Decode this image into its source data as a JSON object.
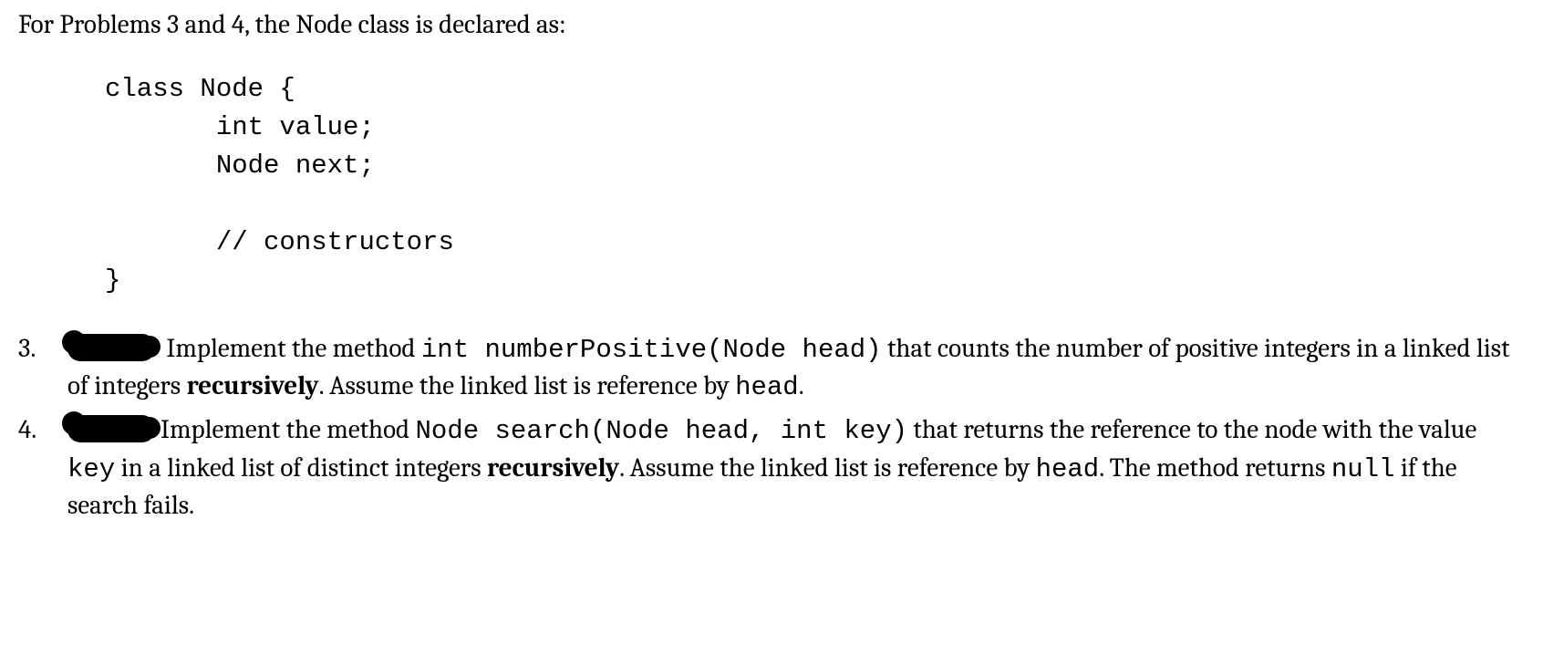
{
  "intro": "For Problems 3 and 4, the Node class is declared as:",
  "code": "class Node {\n       int value;\n       Node next;\n\n       // constructors\n}",
  "problems": {
    "p3": {
      "t1": " Implement the method ",
      "sig": "int numberPositive(Node head)",
      "t2": " that counts the number of positive integers in a linked list of integers ",
      "bold": "recursively",
      "t3": ".  Assume the linked list is reference by ",
      "headword": "head",
      "t4": "."
    },
    "p4": {
      "t1": "Implement the method ",
      "sig": "Node search(Node head, int key)",
      "t2": " that returns the reference to the node with the value ",
      "key": "key",
      "t3": " in a linked list of distinct integers ",
      "bold": "recursively",
      "t4": ". Assume the linked list is reference by ",
      "headword": "head",
      "t5": ".  The method returns ",
      "nullword": "null",
      "t6": " if the search fails."
    }
  }
}
